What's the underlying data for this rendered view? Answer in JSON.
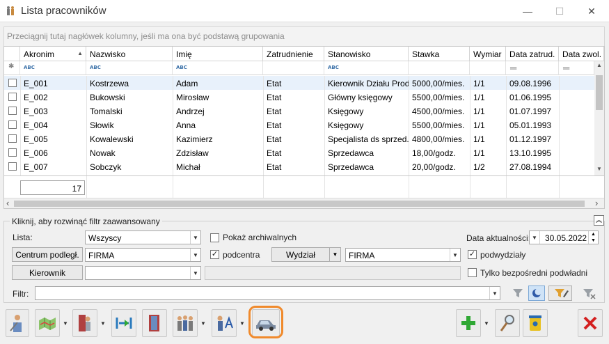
{
  "window": {
    "title": "Lista pracowników",
    "minimize": "—",
    "maximize": "☐",
    "close": "✕"
  },
  "group_hint": "Przeciągnij tutaj nagłówek kolumny, jeśli ma ona być podstawą grupowania",
  "columns": [
    "Akronim",
    "Nazwisko",
    "Imię",
    "Zatrudnienie",
    "Stanowisko",
    "Stawka",
    "Wymiar",
    "Data zatrud.",
    "Data zwol."
  ],
  "filter_row": {
    "abc": "ABC",
    "eq": "═"
  },
  "rows": [
    [
      "E_001",
      "Kostrzewa",
      "Adam",
      "Etat",
      "Kierownik Działu Prod...",
      "5000,00/mies.",
      "1/1",
      "09.08.1996",
      ""
    ],
    [
      "E_002",
      "Bukowski",
      "Mirosław",
      "Etat",
      "Główny księgowy",
      "5500,00/mies.",
      "1/1",
      "01.06.1995",
      ""
    ],
    [
      "E_003",
      "Tomalski",
      "Andrzej",
      "Etat",
      "Księgowy",
      "4500,00/mies.",
      "1/1",
      "01.07.1997",
      ""
    ],
    [
      "E_004",
      "Słowik",
      "Anna",
      "Etat",
      "Księgowy",
      "5500,00/mies.",
      "1/1",
      "05.01.1993",
      ""
    ],
    [
      "E_005",
      "Kowalewski",
      "Kazimierz",
      "Etat",
      "Specjalista ds sprzed...",
      "4800,00/mies.",
      "1/1",
      "01.12.1997",
      ""
    ],
    [
      "E_006",
      "Nowak",
      "Zdzisław",
      "Etat",
      "Sprzedawca",
      "18,00/godz.",
      "1/1",
      "13.10.1995",
      ""
    ],
    [
      "E_007",
      "Sobczyk",
      "Michał",
      "Etat",
      "Sprzedawca",
      "20,00/godz.",
      "1/2",
      "27.08.1994",
      ""
    ]
  ],
  "row_count": "17",
  "filters": {
    "panel_title": "Kliknij, aby rozwinąć filtr zaawansowany",
    "lista_label": "Lista:",
    "lista_value": "Wszyscy",
    "show_archived": "Pokaż archiwalnych",
    "date_label": "Data aktualności:",
    "date_value": "30.05.2022",
    "centrum_button": "Centrum podległ.",
    "centrum_value": "FIRMA",
    "podcentra": "podcentra",
    "wydzial_button": "Wydział",
    "wydzial_value": "FIRMA",
    "podwydzialy": "podwydziały",
    "kierownik_button": "Kierownik",
    "kierownik_value": "",
    "only_direct": "Tylko bezpośredni podwładni",
    "filtr_label": "Filtr:",
    "filtr_value": ""
  },
  "icons": {
    "sort": "▲",
    "dropdown": "▼",
    "scroll_up": "▲",
    "scroll_down": "▼",
    "scroll_left": "‹",
    "scroll_right": "›",
    "collapse": "︽",
    "check": "✓",
    "pin": "✱"
  },
  "colors": {
    "accent": "#f08a2c",
    "add": "#2fa834",
    "delete": "#d42020"
  }
}
